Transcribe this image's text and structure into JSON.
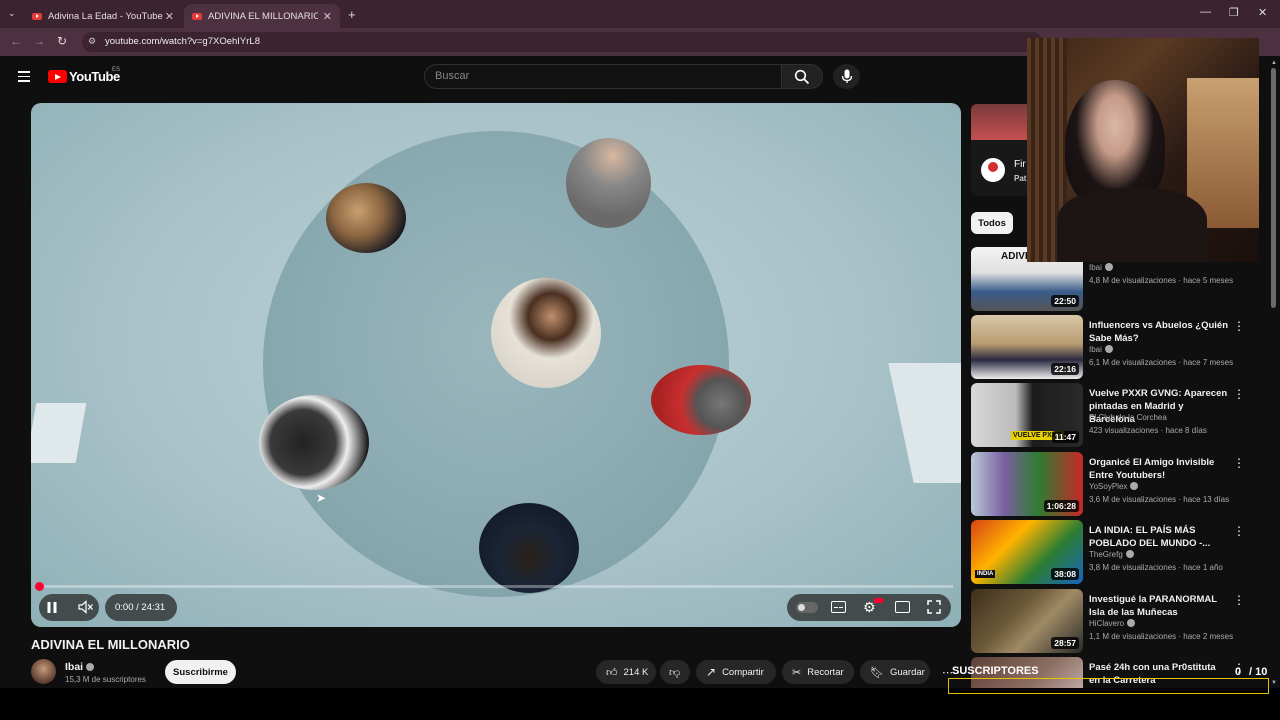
{
  "browser": {
    "tabs": [
      {
        "title": "Adivina La Edad - YouTube",
        "active": false
      },
      {
        "title": "ADIVINA EL MILLONARIO - You",
        "active": true
      }
    ],
    "url": "youtube.com/watch?v=g7XOehIYrL8"
  },
  "header": {
    "logo_text": "YouTube",
    "region": "ES",
    "search_placeholder": "Buscar"
  },
  "player": {
    "time": "0:00 / 24:31",
    "progress_fraction": 0.0,
    "state": "playing",
    "muted": true
  },
  "video": {
    "title": "ADIVINA EL MILLONARIO",
    "channel": "Ibai",
    "subscribers": "15,3 M de suscriptores",
    "subscribe_label": "Suscribirme",
    "likes": "214 K",
    "share_label": "Compartir",
    "clip_label": "Recortar",
    "save_label": "Guardar"
  },
  "sidebar": {
    "ad_text": "Fir",
    "ad_sub": "Pat",
    "chip_all": "Todos",
    "recommendations": [
      {
        "title": "ADIVINA EL GÉNERO",
        "channel": "Ibai",
        "verified": true,
        "meta": "4,8 M de visualizaciones · hace 5 meses",
        "duration": "22:50"
      },
      {
        "title": "Influencers vs Abuelos ¿Quién Sabe Más?",
        "channel": "Ibai",
        "verified": true,
        "meta": "6,1 M de visualizaciones · hace 7 meses",
        "duration": "22:16"
      },
      {
        "title": "Vuelve PXXR GVNG: Aparecen pintadas en Madrid y Barcelona",
        "channel": "El Club de la Corchea",
        "verified": false,
        "meta": "423 visualizaciones · hace 8 días",
        "duration": "11:47"
      },
      {
        "title": "Organicé El Amigo Invisible Entre Youtubers!",
        "channel": "YoSoyPlex",
        "verified": true,
        "meta": "3,6 M de visualizaciones · hace 13 días",
        "duration": "1:06:28"
      },
      {
        "title": "LA INDIA: EL PAÍS MÁS POBLADO DEL MUNDO -...",
        "channel": "TheGrefg",
        "verified": true,
        "meta": "3,8 M de visualizaciones · hace 1 año",
        "duration": "38:08"
      },
      {
        "title": "Investigué la PARANORMAL Isla de las Muñecas",
        "channel": "HiClavero",
        "verified": true,
        "meta": "1,1 M de visualizaciones · hace 2 meses",
        "duration": "28:57"
      },
      {
        "title": "Pasé 24h con una Pr0stituta en la Carretera",
        "channel": "",
        "verified": false,
        "meta": "",
        "duration": ""
      }
    ]
  },
  "overlay": {
    "label": "SUSCRIPTORES",
    "count": "0",
    "goal": "/ 10"
  },
  "colors": {
    "tab_bar": "#3b2330",
    "yt_red": "#ff0000",
    "progress": "#ff0033",
    "overlay_border": "#e6c200"
  }
}
